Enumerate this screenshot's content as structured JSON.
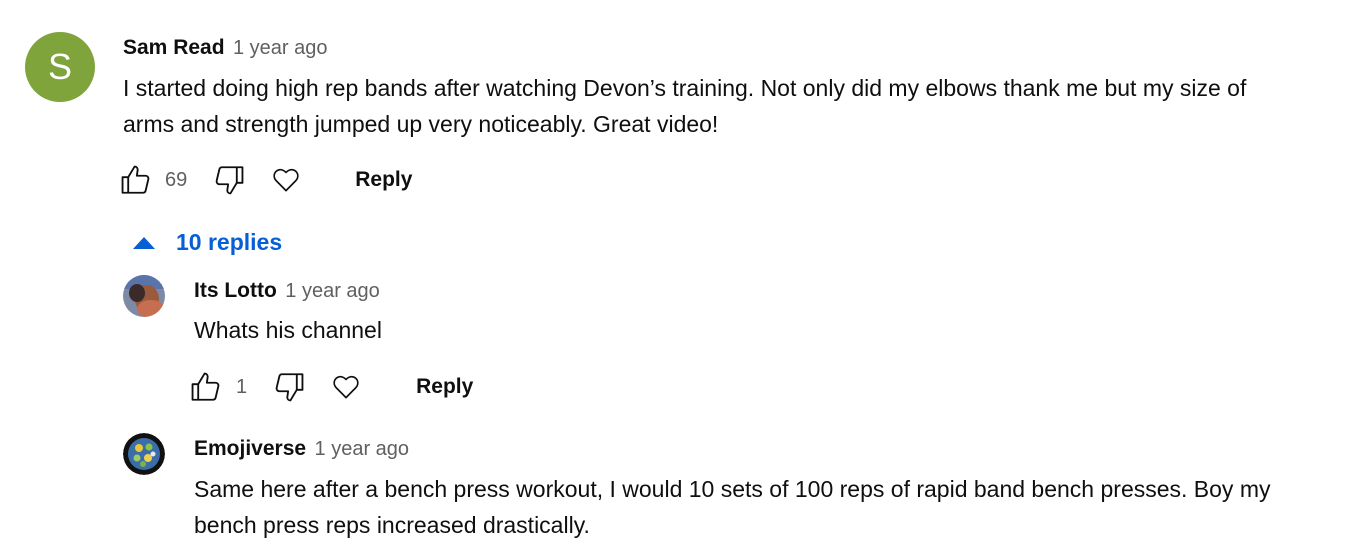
{
  "comment": {
    "avatar_letter": "S",
    "author": "Sam Read",
    "time": "1 year ago",
    "text_line1": "I started doing high rep bands after watching Devon’s training. Not only did my elbows thank me but my size of",
    "text_line2": "arms and strength jumped up very noticeably. Great video!",
    "likes": "69",
    "reply_label": "Reply"
  },
  "replies_toggle": {
    "label": "10 replies"
  },
  "replies": [
    {
      "author": "Its Lotto",
      "time": "1 year ago",
      "text_line1": "Whats his channel",
      "likes": "1",
      "reply_label": "Reply"
    },
    {
      "author": "Emojiverse",
      "time": "1 year ago",
      "text_line1": "Same here after a bench press workout, I would 10 sets of 100 reps of  rapid band bench presses. Boy my",
      "text_line2": "bench press reps increased drastically."
    }
  ],
  "icons": {
    "like": "thumbs-up-icon",
    "dislike": "thumbs-down-icon",
    "heart": "heart-icon",
    "expand": "caret-up-icon"
  },
  "colors": {
    "link_blue": "#065fd4",
    "avatar_green": "#7fa43c",
    "secondary_text": "#606060"
  }
}
